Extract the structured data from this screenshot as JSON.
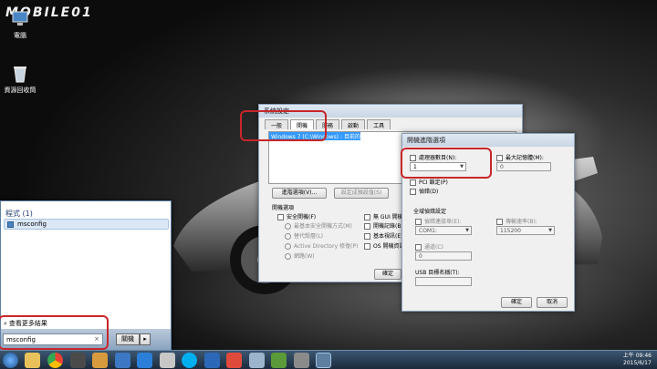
{
  "logo": {
    "text": "MOBILE01"
  },
  "desktop_icons": [
    {
      "label": "電腦",
      "icon": "computer-icon"
    },
    {
      "label": "資源回收筒",
      "icon": "recycle-bin-icon"
    }
  ],
  "sysconfig": {
    "title": "系統設定",
    "tabs": [
      "一般",
      "開機",
      "服務",
      "啟動",
      "工具"
    ],
    "os_entry": "Windows 7 (C:\\Windows) : 目前的 OS; 預設 OS",
    "advanced_button": "進階選項(V)...",
    "set_default_button": "設定成預設值(S)",
    "boot_options_label": "開機選項",
    "safe_boot": "安全開機(F)",
    "minimal": "最基本安全開機方式(M)",
    "alt_shell": "替代殼層(L)",
    "ad_repair": "Active Directory 修復(P)",
    "network": "網路(W)",
    "no_gui": "無 GUI 開機(N)",
    "boot_log": "開機記錄(B)",
    "base_video": "基本視訊(E)",
    "os_boot_info": "OS 開機資訊(O)",
    "ok_button": "確定"
  },
  "advanced": {
    "title": "開機進階選項",
    "num_processors_label": "處理器數目(N):",
    "num_processors_value": "1",
    "max_memory_label": "最大記憶體(M):",
    "max_memory_value": "0",
    "pci_lock": "PCI 鎖定(P)",
    "debug": "偵錯(D)",
    "global_debug_label": "全域偵錯設定",
    "debug_port_label": "偵錯連接埠(E):",
    "debug_port_value": "COM1:",
    "baud_rate_label": "傳輸速率(B):",
    "baud_rate_value": "115200",
    "channel_label": "通道(C)",
    "channel_value": "0",
    "usb_target_label": "USB 目標名稱(T):",
    "ok_button": "確定",
    "cancel_button": "取消"
  },
  "startmenu": {
    "section_header": "程式 (1)",
    "program_item": "msconfig",
    "see_more": "查看更多結果",
    "search_value": "msconfig",
    "clear_glyph": "×",
    "shutdown_button": "關機",
    "arrow_glyph": "▸"
  },
  "taskbar": {
    "time": "上午 09:46",
    "date": "2015/6/17",
    "icons": [
      "start-orb-icon",
      "explorer-icon",
      "chrome-icon",
      "media-icon",
      "cat-icon",
      "flag-icon",
      "play-icon",
      "tag-icon",
      "skype-icon",
      "m-icon",
      "mobile01-icon",
      "window-icon",
      "chat-icon",
      "settings-icon",
      "msconfig-icon"
    ]
  }
}
